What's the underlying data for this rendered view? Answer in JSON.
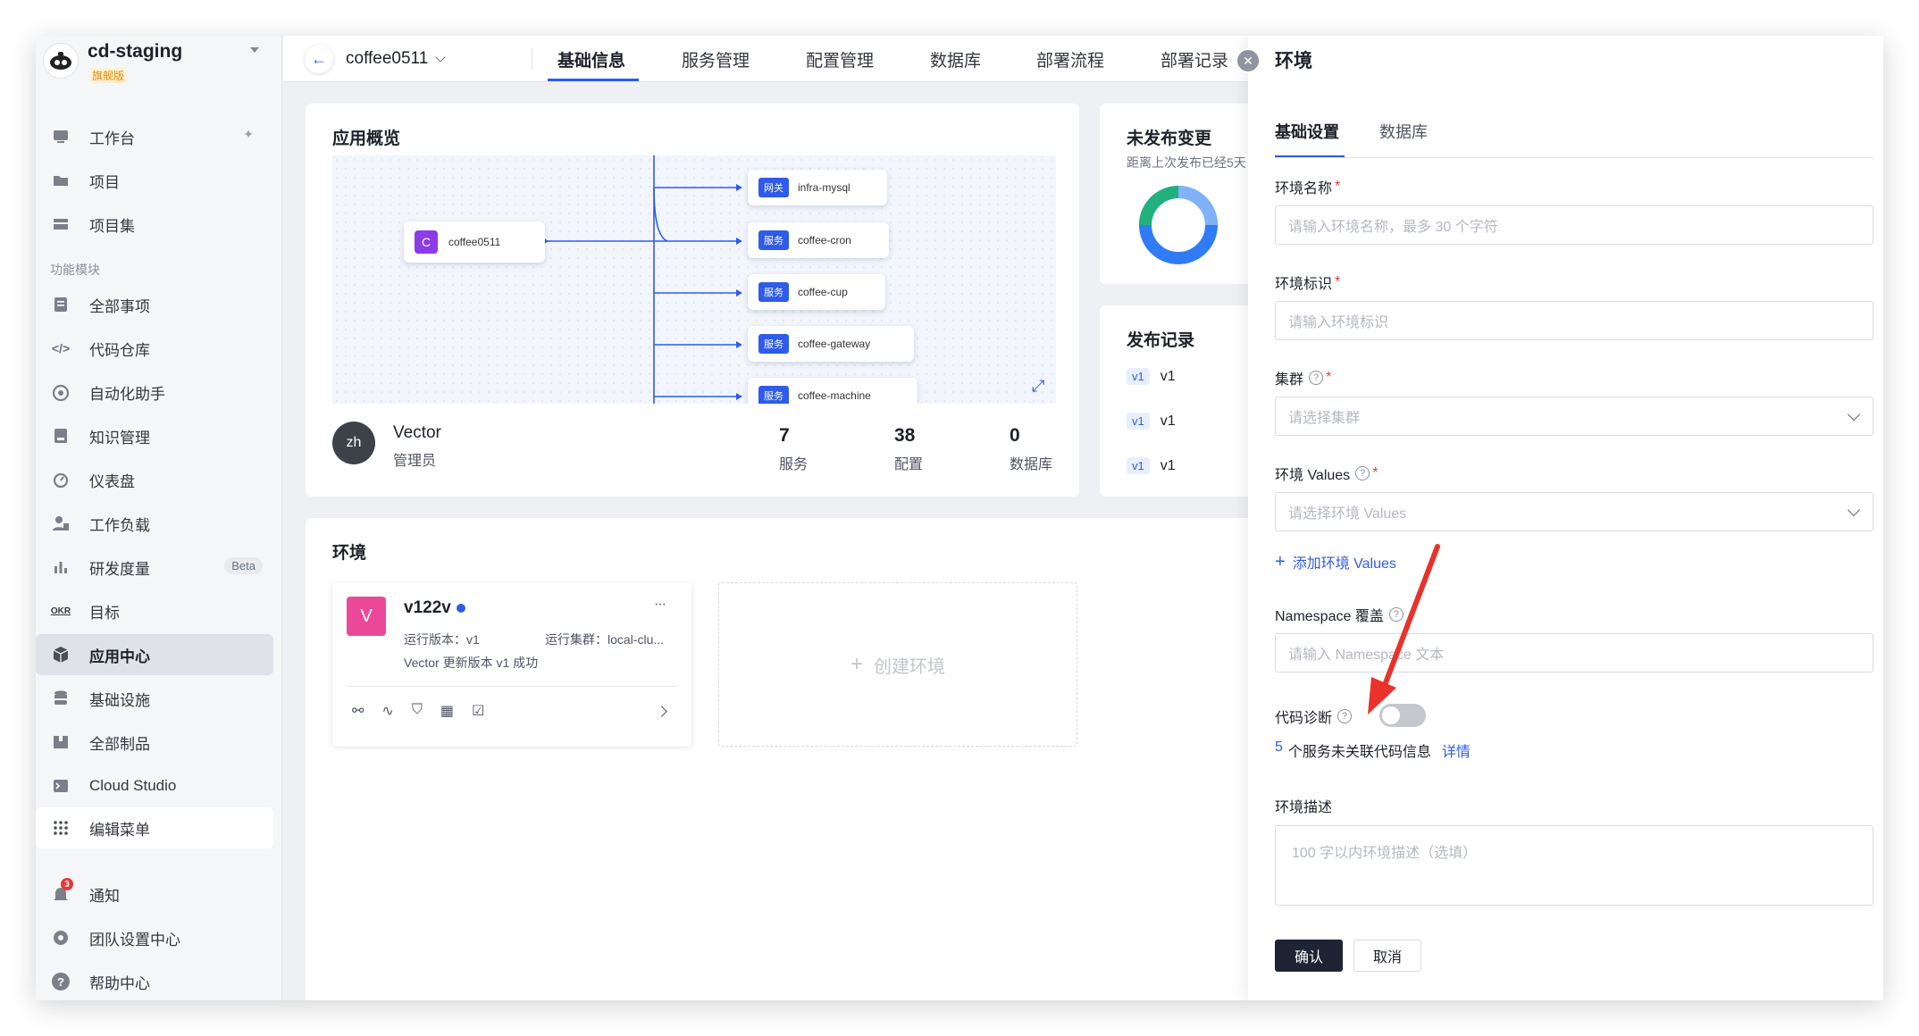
{
  "workspace": {
    "name": "cd-staging",
    "badge": "旗舰版"
  },
  "sidebar": {
    "items": [
      {
        "label": "工作台",
        "icon": "monitor-icon"
      },
      {
        "label": "项目",
        "icon": "folder-icon"
      },
      {
        "label": "项目集",
        "icon": "stack-icon"
      },
      {
        "label": "全部事项",
        "icon": "list-icon"
      },
      {
        "label": "代码仓库",
        "icon": "code-icon"
      },
      {
        "label": "自动化助手",
        "icon": "robot-icon"
      },
      {
        "label": "知识管理",
        "icon": "book-icon"
      },
      {
        "label": "仪表盘",
        "icon": "gauge-icon"
      },
      {
        "label": "工作负载",
        "icon": "user-workload-icon"
      },
      {
        "label": "研发度量",
        "icon": "bar-chart-icon",
        "badge": "Beta"
      },
      {
        "label": "目标",
        "icon": "okr-icon"
      },
      {
        "label": "应用中心",
        "icon": "cube-icon"
      },
      {
        "label": "基础设施",
        "icon": "database-icon"
      },
      {
        "label": "全部制品",
        "icon": "package-icon"
      },
      {
        "label": "Cloud Studio",
        "icon": "terminal-icon"
      },
      {
        "label": "编辑菜单",
        "icon": "grid-icon"
      }
    ],
    "group_label": "功能模块",
    "okr_glyph": "OKR",
    "bottom": [
      {
        "label": "通知",
        "icon": "bell-icon",
        "count": "3"
      },
      {
        "label": "团队设置中心",
        "icon": "settings-icon"
      },
      {
        "label": "帮助中心",
        "icon": "help-icon",
        "glyph": "?"
      }
    ]
  },
  "header": {
    "app_name": "coffee0511",
    "tabs": [
      "基础信息",
      "服务管理",
      "配置管理",
      "数据库",
      "部署流程",
      "部署记录"
    ]
  },
  "overview": {
    "title": "应用概览",
    "root_node": {
      "letter": "C",
      "name": "coffee0511"
    },
    "nodes": [
      {
        "tag": "网关",
        "name": "infra-mysql"
      },
      {
        "tag": "服务",
        "name": "coffee-cron"
      },
      {
        "tag": "服务",
        "name": "coffee-cup"
      },
      {
        "tag": "服务",
        "name": "coffee-gateway"
      },
      {
        "tag": "服务",
        "name": "coffee-machine"
      }
    ],
    "owner": {
      "avatar": "zh",
      "name": "Vector",
      "role": "管理员"
    },
    "stats": [
      {
        "value": "7",
        "label": "服务"
      },
      {
        "value": "38",
        "label": "配置"
      },
      {
        "value": "0",
        "label": "数据库"
      }
    ]
  },
  "unpublished": {
    "title": "未发布变更",
    "subtitle": "距离上次发布已经5天"
  },
  "releases": {
    "title": "发布记录",
    "items": [
      {
        "tag": "v1",
        "text": "v1"
      },
      {
        "tag": "v1",
        "text": "v1"
      },
      {
        "tag": "v1",
        "text": "v1"
      }
    ]
  },
  "environments": {
    "title": "环境",
    "env": {
      "letter": "V",
      "name": "v122v",
      "more": "···",
      "run_version": "运行版本：v1",
      "run_cluster": "运行集群：local-clu...",
      "message": "Vector 更新版本 v1 成功"
    },
    "create_label": "创建环境"
  },
  "drawer": {
    "title": "环境",
    "tabs": [
      "基础设置",
      "数据库"
    ],
    "name_label": "环境名称",
    "name_placeholder": "请输入环境名称，最多 30 个字符",
    "id_label": "环境标识",
    "id_placeholder": "请输入环境标识",
    "cluster_label": "集群",
    "cluster_placeholder": "请选择集群",
    "values_label": "环境 Values",
    "values_placeholder": "请选择环境 Values",
    "add_values": "添加环境 Values",
    "ns_label": "Namespace 覆盖",
    "ns_placeholder": "请输入 Namespace 文本",
    "diag_label": "代码诊断",
    "diag_enabled": false,
    "diag_count": "5",
    "diag_text": "个服务未关联代码信息",
    "diag_link": "详情",
    "desc_label": "环境描述",
    "desc_placeholder": "100 字以内环境描述（选填）",
    "confirm": "确认",
    "cancel": "取消"
  },
  "colors": {
    "accent": "#2f5bea",
    "primary_button": "#1e2433",
    "arrow": "#e8322b",
    "env_avatar": "#ec4899",
    "root_avatar": "#8b3be8"
  }
}
